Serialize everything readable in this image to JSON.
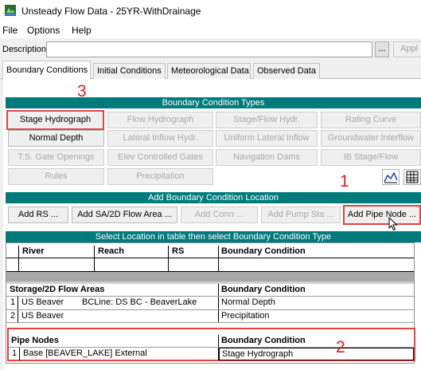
{
  "window": {
    "title": "Unsteady Flow Data - 25YR-WithDrainage"
  },
  "menu": [
    "File",
    "Options",
    "Help"
  ],
  "description": {
    "label": "Description:",
    "value": "",
    "browse_label": "...",
    "apply_label": "Appl"
  },
  "tabs": [
    "Boundary Conditions",
    "Initial Conditions",
    "Meteorological Data",
    "Observed Data"
  ],
  "annotations": {
    "n1": "1",
    "n2": "2",
    "n3": "3"
  },
  "bc_types": {
    "header": "Boundary Condition Types",
    "buttons": [
      "Stage Hydrograph",
      "Flow Hydrograph",
      "Stage/Flow Hydr.",
      "Rating Curve",
      "Normal Depth",
      "Lateral Inflow Hydr.",
      "Uniform Lateral Inflow",
      "Groundwater Interflow",
      "T.S. Gate Openings",
      "Elev Controlled Gates",
      "Navigation Dams",
      "IB Stage/Flow",
      "Rules",
      "Precipitation"
    ]
  },
  "add_location": {
    "header": "Add Boundary Condition Location",
    "buttons": [
      "Add RS ...",
      "Add SA/2D Flow Area ...",
      "Add Conn ...",
      "Add Pump Sta ...",
      "Add Pipe Node ..."
    ]
  },
  "table": {
    "header": "Select Location in table then select Boundary Condition Type",
    "river_headers": [
      "River",
      "Reach",
      "RS",
      "Boundary Condition"
    ],
    "storage_headers": [
      "Storage/2D Flow Areas",
      "Boundary Condition"
    ],
    "storage_rows": [
      {
        "n": "1",
        "name": "US Beaver",
        "bcline": "BCLine: DS BC - BeaverLake",
        "bc": "Normal Depth"
      },
      {
        "n": "2",
        "name": "US Beaver",
        "bcline": "",
        "bc": "Precipitation"
      }
    ],
    "pipe_headers": [
      "Pipe Nodes",
      "Boundary Condition"
    ],
    "pipe_rows": [
      {
        "n": "1",
        "name": "Base [BEAVER_LAKE] External",
        "bc": "Stage Hydrograph"
      }
    ]
  },
  "colors": {
    "header_bg": "#007b7b",
    "annotation": "#e0201a"
  }
}
